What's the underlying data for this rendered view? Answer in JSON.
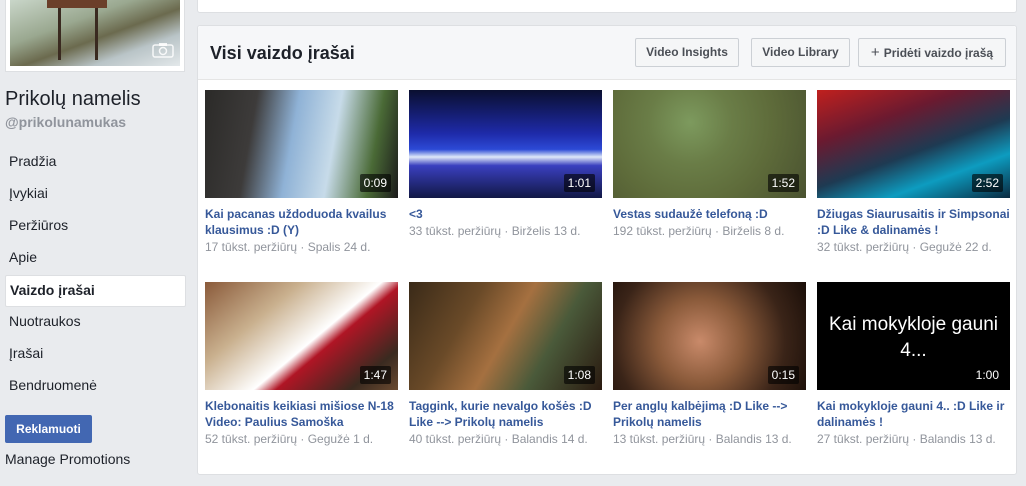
{
  "page": {
    "name": "Prikolų namelis",
    "handle": "@prikolunamukas"
  },
  "nav": [
    {
      "label": "Pradžia",
      "name": "nav-home"
    },
    {
      "label": "Įvykiai",
      "name": "nav-events"
    },
    {
      "label": "Peržiūros",
      "name": "nav-reviews"
    },
    {
      "label": "Apie",
      "name": "nav-about"
    },
    {
      "label": "Vaizdo įrašai",
      "name": "nav-videos",
      "active": true
    },
    {
      "label": "Nuotraukos",
      "name": "nav-photos"
    },
    {
      "label": "Įrašai",
      "name": "nav-posts"
    },
    {
      "label": "Bendruomenė",
      "name": "nav-community"
    }
  ],
  "sidebar": {
    "promote_label": "Reklamuoti",
    "manage_label": "Manage Promotions"
  },
  "videos_section": {
    "title": "Visi vaizdo įrašai",
    "insights_label": "Video Insights",
    "library_label": "Video Library",
    "add_label": "Pridėti vaizdo įrašą"
  },
  "videos": [
    {
      "title": "Kai pacanas uždoduoda kvailus klausimus :D (Y)",
      "duration": "0:09",
      "meta": "17 tūkst. peržiūrų · Spalis 24 d."
    },
    {
      "title": "<3",
      "duration": "1:01",
      "meta": "33 tūkst. peržiūrų · Birželis 13 d."
    },
    {
      "title": "Vestas sudaužė telefoną :D",
      "duration": "1:52",
      "meta": "192 tūkst. peržiūrų · Birželis 8 d."
    },
    {
      "title": "Džiugas Siaurusaitis ir Simpsonai :D Like & dalinamės !",
      "duration": "2:52",
      "meta": "32 tūkst. peržiūrų · Gegužė 22 d."
    },
    {
      "title": "Klebonaitis keikiasi mišiose N-18 Video: Paulius Samoška",
      "duration": "1:47",
      "meta": "52 tūkst. peržiūrų · Gegužė 1 d."
    },
    {
      "title": "Taggink, kurie nevalgo košės :D Like --> Prikolų namelis",
      "duration": "1:08",
      "meta": "40 tūkst. peržiūrų · Balandis 14 d."
    },
    {
      "title": "Per anglų kalbėjimą :D Like --> Prikolų namelis",
      "duration": "0:15",
      "meta": "13 tūkst. peržiūrų · Balandis 13 d."
    },
    {
      "title": "Kai mokykloje gauni 4.. :D Like ir dalinamės !",
      "duration": "1:00",
      "meta": "27 tūkst. peržiūrų · Balandis 13 d.",
      "slide_text": "Kai mokykloje gauni 4..."
    }
  ]
}
